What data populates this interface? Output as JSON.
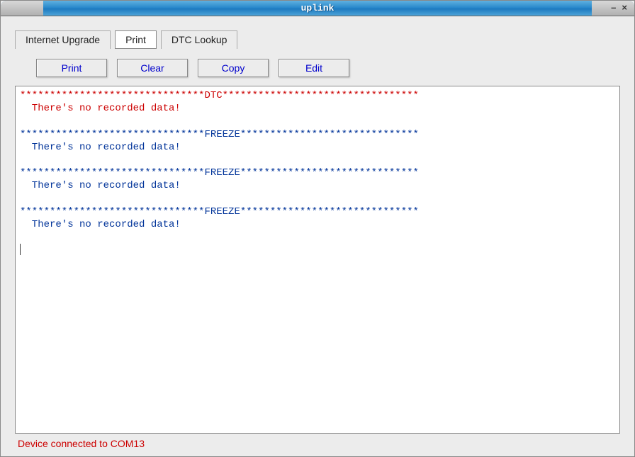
{
  "window": {
    "title": "uplink",
    "minimize": "–",
    "close": "×"
  },
  "tabs": {
    "internet_upgrade": "Internet Upgrade",
    "print": "Print",
    "dtc_lookup": "DTC Lookup"
  },
  "buttons": {
    "print": "Print",
    "clear": "Clear",
    "copy": "Copy",
    "edit": "Edit"
  },
  "output": {
    "sections": [
      {
        "header": "*******************************DTC*********************************",
        "body": "  There's no recorded data!",
        "color": "red"
      },
      {
        "header": "*******************************FREEZE******************************",
        "body": "  There's no recorded data!",
        "color": "blue"
      },
      {
        "header": "*******************************FREEZE******************************",
        "body": "  There's no recorded data!",
        "color": "blue"
      },
      {
        "header": "*******************************FREEZE******************************",
        "body": "  There's no recorded data!",
        "color": "blue"
      }
    ]
  },
  "status": "Device connected to COM13"
}
